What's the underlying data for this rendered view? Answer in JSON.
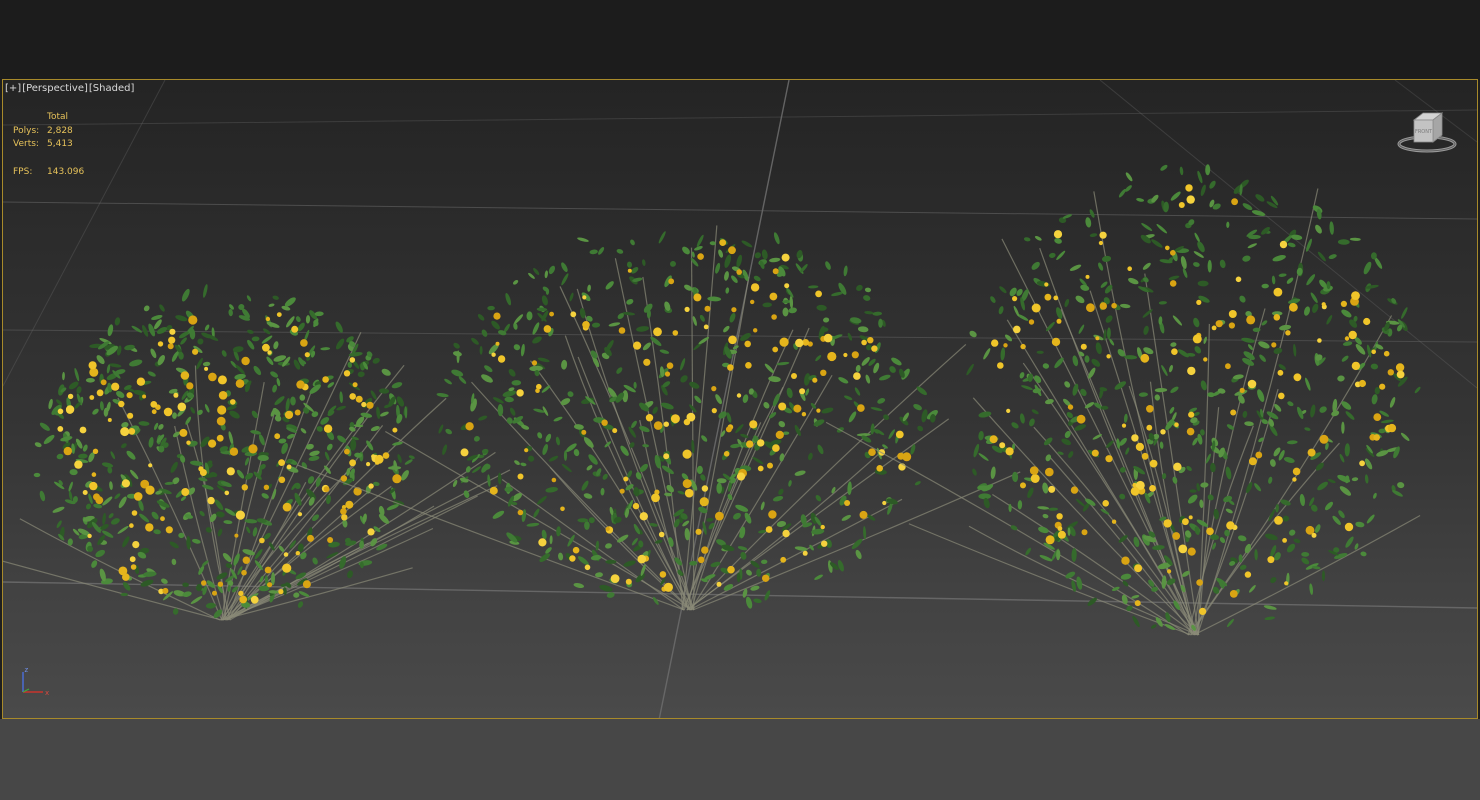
{
  "viewport": {
    "label_plus": "[+]",
    "label_view": "[Perspective]",
    "label_shading": "[Shaded]"
  },
  "stats": {
    "header": "Total",
    "polys_label": "Polys:",
    "polys_value": "2,828",
    "verts_label": "Verts:",
    "verts_value": "5,413",
    "fps_label": "FPS:",
    "fps_value": "143.096"
  },
  "viewcube": {
    "face_label": "FRONT"
  },
  "axis": {
    "z": "z",
    "x": "x"
  },
  "colors": {
    "viewport_border": "#a88a2a",
    "stats_text": "#e6c25a",
    "grid_line": "#6a6a6a",
    "leaf": "#3f7a34",
    "flower": "#e5b51c"
  }
}
